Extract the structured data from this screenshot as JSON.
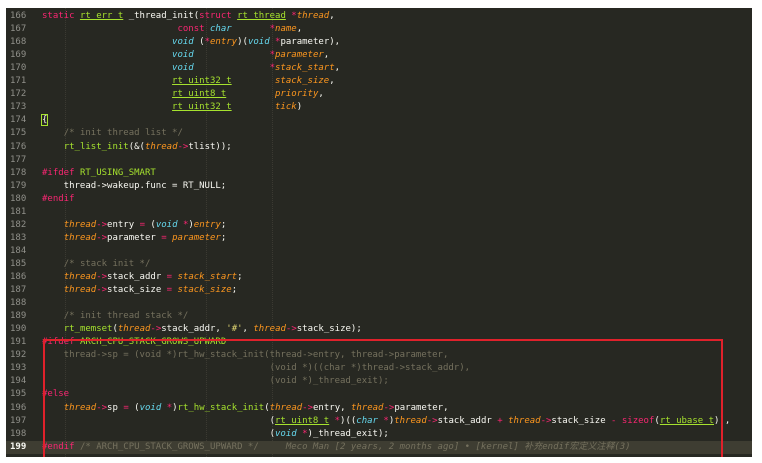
{
  "editor": {
    "lines": [
      {
        "n": "166",
        "t": [
          [
            "kw",
            "static "
          ],
          [
            "ut",
            "rt_err_t"
          ],
          [
            "wt",
            " _thread_init("
          ],
          [
            "kw",
            "struct "
          ],
          [
            "ut",
            "rt_thread"
          ],
          [
            "kw",
            " *"
          ],
          [
            "pa",
            "thread"
          ],
          [
            "wt",
            ","
          ]
        ]
      },
      {
        "n": "167",
        "t": [
          [
            "wt",
            "                         "
          ],
          [
            "kw",
            "const "
          ],
          [
            "ty",
            "char"
          ],
          [
            "wt",
            "       "
          ],
          [
            "kw",
            "*"
          ],
          [
            "pa",
            "name"
          ],
          [
            "wt",
            ","
          ]
        ]
      },
      {
        "n": "168",
        "t": [
          [
            "wt",
            "                        "
          ],
          [
            "ty",
            "void"
          ],
          [
            "wt",
            " ("
          ],
          [
            "kw",
            "*"
          ],
          [
            "pa",
            "entry"
          ],
          [
            "wt",
            ")("
          ],
          [
            "ty",
            "void"
          ],
          [
            "wt",
            " "
          ],
          [
            "kw",
            "*"
          ],
          [
            "wt",
            "parameter),"
          ]
        ]
      },
      {
        "n": "169",
        "t": [
          [
            "wt",
            "                        "
          ],
          [
            "ty",
            "void"
          ],
          [
            "wt",
            "              "
          ],
          [
            "kw",
            "*"
          ],
          [
            "pa",
            "parameter"
          ],
          [
            "wt",
            ","
          ]
        ]
      },
      {
        "n": "170",
        "t": [
          [
            "wt",
            "                        "
          ],
          [
            "ty",
            "void"
          ],
          [
            "wt",
            "              "
          ],
          [
            "kw",
            "*"
          ],
          [
            "pa",
            "stack_start"
          ],
          [
            "wt",
            ","
          ]
        ]
      },
      {
        "n": "171",
        "t": [
          [
            "wt",
            "                        "
          ],
          [
            "ut",
            "rt_uint32_t"
          ],
          [
            "wt",
            "        "
          ],
          [
            "pa",
            "stack_size"
          ],
          [
            "wt",
            ","
          ]
        ]
      },
      {
        "n": "172",
        "t": [
          [
            "wt",
            "                        "
          ],
          [
            "ut",
            "rt_uint8_t"
          ],
          [
            "wt",
            "         "
          ],
          [
            "pa",
            "priority"
          ],
          [
            "wt",
            ","
          ]
        ]
      },
      {
        "n": "173",
        "t": [
          [
            "wt",
            "                        "
          ],
          [
            "ut",
            "rt_uint32_t"
          ],
          [
            "wt",
            "        "
          ],
          [
            "pa",
            "tick"
          ],
          [
            "wt",
            ")"
          ]
        ]
      },
      {
        "n": "174",
        "t": [
          [
            "brace",
            "{"
          ]
        ]
      },
      {
        "n": "175",
        "t": [
          [
            "wt",
            "    "
          ],
          [
            "cm",
            "/* init thread list */"
          ]
        ]
      },
      {
        "n": "176",
        "t": [
          [
            "wt",
            "    "
          ],
          [
            "fn",
            "rt_list_init"
          ],
          [
            "wt",
            "(&("
          ],
          [
            "pa",
            "thread"
          ],
          [
            "kw",
            "->"
          ],
          [
            "wt",
            "tlist));"
          ]
        ]
      },
      {
        "n": "177",
        "t": []
      },
      {
        "n": "178",
        "t": [
          [
            "pp",
            "#ifdef"
          ],
          [
            "wt",
            " "
          ],
          [
            "mc",
            "RT_USING_SMART"
          ]
        ]
      },
      {
        "n": "179",
        "t": [
          [
            "wt",
            "    thread->wakeup.func = RT_NULL;"
          ]
        ]
      },
      {
        "n": "180",
        "t": [
          [
            "pp",
            "#endif"
          ]
        ]
      },
      {
        "n": "181",
        "t": []
      },
      {
        "n": "182",
        "t": [
          [
            "wt",
            "    "
          ],
          [
            "pa",
            "thread"
          ],
          [
            "kw",
            "->"
          ],
          [
            "wt",
            "entry "
          ],
          [
            "kw",
            "="
          ],
          [
            "wt",
            " ("
          ],
          [
            "ty",
            "void"
          ],
          [
            "wt",
            " "
          ],
          [
            "kw",
            "*"
          ],
          [
            "wt",
            ")"
          ],
          [
            "pa",
            "entry"
          ],
          [
            "wt",
            ";"
          ]
        ]
      },
      {
        "n": "183",
        "t": [
          [
            "wt",
            "    "
          ],
          [
            "pa",
            "thread"
          ],
          [
            "kw",
            "->"
          ],
          [
            "wt",
            "parameter "
          ],
          [
            "kw",
            "="
          ],
          [
            "wt",
            " "
          ],
          [
            "pa",
            "parameter"
          ],
          [
            "wt",
            ";"
          ]
        ]
      },
      {
        "n": "184",
        "t": []
      },
      {
        "n": "185",
        "t": [
          [
            "wt",
            "    "
          ],
          [
            "cm",
            "/* stack init */"
          ]
        ]
      },
      {
        "n": "186",
        "t": [
          [
            "wt",
            "    "
          ],
          [
            "pa",
            "thread"
          ],
          [
            "kw",
            "->"
          ],
          [
            "wt",
            "stack_addr "
          ],
          [
            "kw",
            "="
          ],
          [
            "wt",
            " "
          ],
          [
            "pa",
            "stack_start"
          ],
          [
            "wt",
            ";"
          ]
        ]
      },
      {
        "n": "187",
        "t": [
          [
            "wt",
            "    "
          ],
          [
            "pa",
            "thread"
          ],
          [
            "kw",
            "->"
          ],
          [
            "wt",
            "stack_size "
          ],
          [
            "kw",
            "="
          ],
          [
            "wt",
            " "
          ],
          [
            "pa",
            "stack_size"
          ],
          [
            "wt",
            ";"
          ]
        ]
      },
      {
        "n": "188",
        "t": []
      },
      {
        "n": "189",
        "t": [
          [
            "wt",
            "    "
          ],
          [
            "cm",
            "/* init thread stack */"
          ]
        ]
      },
      {
        "n": "190",
        "t": [
          [
            "wt",
            "    "
          ],
          [
            "fn",
            "rt_memset"
          ],
          [
            "wt",
            "("
          ],
          [
            "pa",
            "thread"
          ],
          [
            "kw",
            "->"
          ],
          [
            "wt",
            "stack_addr, "
          ],
          [
            "st",
            "'#'"
          ],
          [
            "wt",
            ", "
          ],
          [
            "pa",
            "thread"
          ],
          [
            "kw",
            "->"
          ],
          [
            "wt",
            "stack_size);"
          ]
        ]
      },
      {
        "n": "191",
        "t": [
          [
            "pp",
            "#ifdef"
          ],
          [
            "wt",
            " "
          ],
          [
            "mc",
            "ARCH_CPU_STACK_GROWS_UPWARD"
          ]
        ]
      },
      {
        "n": "192",
        "t": [
          [
            "cm",
            "    thread->sp = (void *)rt_hw_stack_init(thread->entry, thread->parameter,"
          ]
        ]
      },
      {
        "n": "193",
        "t": [
          [
            "cm",
            "                                          (void *)((char *)thread->stack_addr),"
          ]
        ]
      },
      {
        "n": "194",
        "t": [
          [
            "cm",
            "                                          (void *)_thread_exit);"
          ]
        ]
      },
      {
        "n": "195",
        "t": [
          [
            "pp",
            "#else"
          ]
        ]
      },
      {
        "n": "196",
        "t": [
          [
            "wt",
            "    "
          ],
          [
            "pa",
            "thread"
          ],
          [
            "kw",
            "->"
          ],
          [
            "wt",
            "sp "
          ],
          [
            "kw",
            "="
          ],
          [
            "wt",
            " ("
          ],
          [
            "ty",
            "void"
          ],
          [
            "wt",
            " "
          ],
          [
            "kw",
            "*"
          ],
          [
            "wt",
            ")"
          ],
          [
            "fn",
            "rt_hw_stack_init"
          ],
          [
            "wt",
            "("
          ],
          [
            "pa",
            "thread"
          ],
          [
            "kw",
            "->"
          ],
          [
            "wt",
            "entry, "
          ],
          [
            "pa",
            "thread"
          ],
          [
            "kw",
            "->"
          ],
          [
            "wt",
            "parameter,"
          ]
        ]
      },
      {
        "n": "197",
        "t": [
          [
            "wt",
            "                                          ("
          ],
          [
            "ut",
            "rt_uint8_t"
          ],
          [
            "wt",
            " "
          ],
          [
            "kw",
            "*"
          ],
          [
            "wt",
            ")(("
          ],
          [
            "ty",
            "char"
          ],
          [
            "wt",
            " "
          ],
          [
            "kw",
            "*"
          ],
          [
            "wt",
            ")"
          ],
          [
            "pa",
            "thread"
          ],
          [
            "kw",
            "->"
          ],
          [
            "wt",
            "stack_addr "
          ],
          [
            "kw",
            "+"
          ],
          [
            "wt",
            " "
          ],
          [
            "pa",
            "thread"
          ],
          [
            "kw",
            "->"
          ],
          [
            "wt",
            "stack_size "
          ],
          [
            "kw",
            "-"
          ],
          [
            "wt",
            " "
          ],
          [
            "kw",
            "sizeof"
          ],
          [
            "wt",
            "("
          ],
          [
            "ut",
            "rt_ubase_t"
          ],
          [
            "wt",
            ")),"
          ]
        ]
      },
      {
        "n": "198",
        "t": [
          [
            "wt",
            "                                          ("
          ],
          [
            "ty",
            "void"
          ],
          [
            "wt",
            " "
          ],
          [
            "kw",
            "*"
          ],
          [
            "wt",
            ")_thread_exit);"
          ]
        ]
      },
      {
        "n": "199",
        "t": [
          [
            "pp",
            "#endif"
          ],
          [
            "wt",
            " "
          ],
          [
            "cm",
            "/* ARCH_CPU_STACK_GROWS_UPWARD */"
          ],
          [
            "wt",
            "     "
          ],
          [
            "bl",
            "Meco Man [2 years, 2 months ago] • [kernel] 补充endif宏定义注释(3)"
          ]
        ]
      }
    ],
    "current_line": "199"
  },
  "colors": {
    "background": "#272822",
    "highlight_box": "#e0212b"
  }
}
